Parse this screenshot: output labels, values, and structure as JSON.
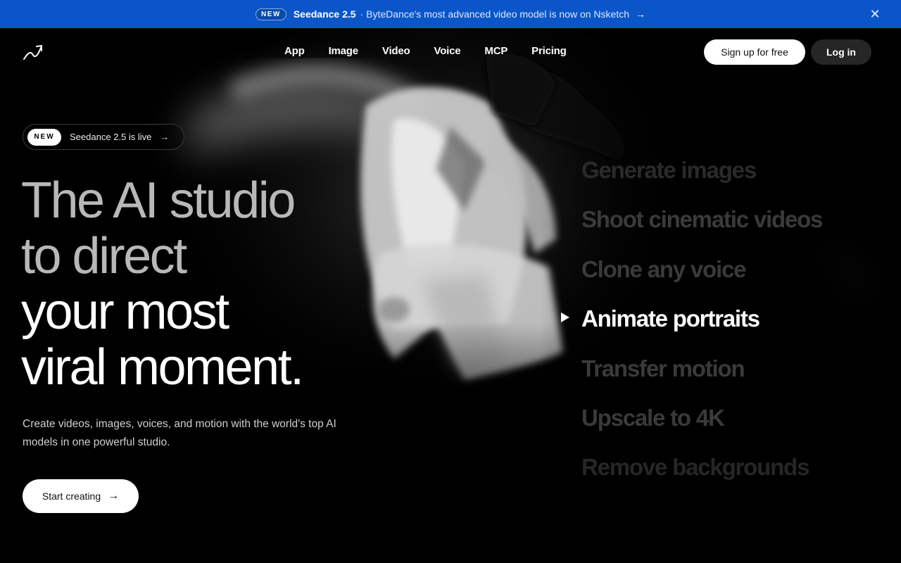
{
  "banner": {
    "pill": "NEW",
    "highlight": "Seedance 2.5",
    "message": "· ByteDance's most advanced video model is now on Nsketch",
    "arrow": "→",
    "close": "✕",
    "bg_color": "#0a56c9"
  },
  "nav": {
    "logo_icon": "logo-icon",
    "items": [
      "App",
      "Image",
      "Video",
      "Voice",
      "MCP",
      "Pricing"
    ],
    "signup": "Sign up for free",
    "login": "Log in"
  },
  "badge": {
    "label": "NEW",
    "text": "Seedance 2.5 is live",
    "arrow": "→"
  },
  "headline": {
    "line1": "The AI studio",
    "line2": "to direct",
    "line3": "your most",
    "line4": "viral moment."
  },
  "subtitle": "Create videos, images, voices, and motion with the world's top AI models in one powerful studio.",
  "cta": {
    "label": "Start creating",
    "arrow": "→"
  },
  "features": {
    "active_index": 3,
    "items": [
      {
        "label": "Generate images",
        "color": "#2a2a2a"
      },
      {
        "label": "Shoot cinematic videos",
        "color": "#3a3a3a"
      },
      {
        "label": "Clone any voice",
        "color": "#3a3a3a"
      },
      {
        "label": "Animate portraits",
        "color": "#ffffff"
      },
      {
        "label": "Transfer motion",
        "color": "#3a3a3a"
      },
      {
        "label": "Upscale to 4K",
        "color": "#3a3a3a"
      },
      {
        "label": "Remove backgrounds",
        "color": "#262626"
      }
    ]
  }
}
